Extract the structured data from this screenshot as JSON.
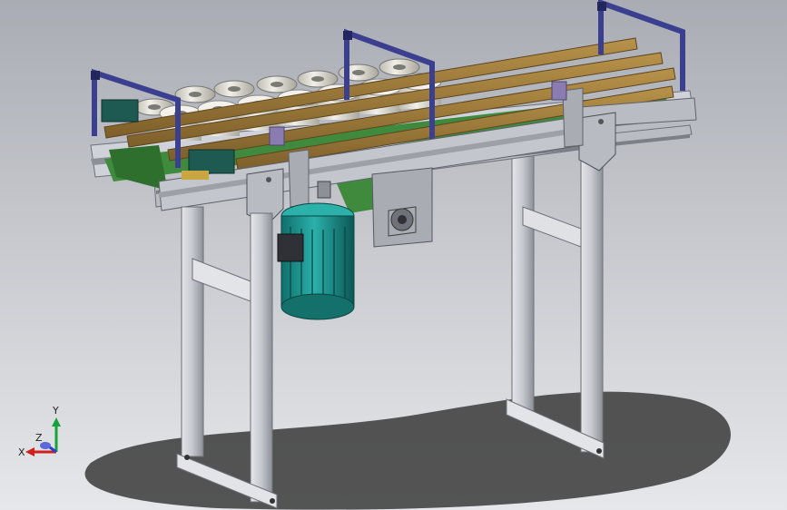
{
  "viewport": {
    "background_top": "#a9acb4",
    "background_bottom": "#e6e7ea"
  },
  "model": {
    "parts": [
      "conveyor-frame",
      "belt",
      "guide-rails",
      "support-legs",
      "drive-motor",
      "bearing-plate",
      "product-rolls"
    ],
    "colors": {
      "frame": "#c9ccd2",
      "frame_dark": "#7d8087",
      "belt": "#3f8a3c",
      "guide_rail": "#9e7c3b",
      "bracket": "#3b3f8f",
      "motor": "#1f8f8a",
      "roll": "#e9e7e0"
    }
  },
  "triad": {
    "x_label": "X",
    "y_label": "Y",
    "z_label": "Z",
    "x_color": "#d0201c",
    "y_color": "#17a33a",
    "z_color": "#2b3fd0"
  }
}
